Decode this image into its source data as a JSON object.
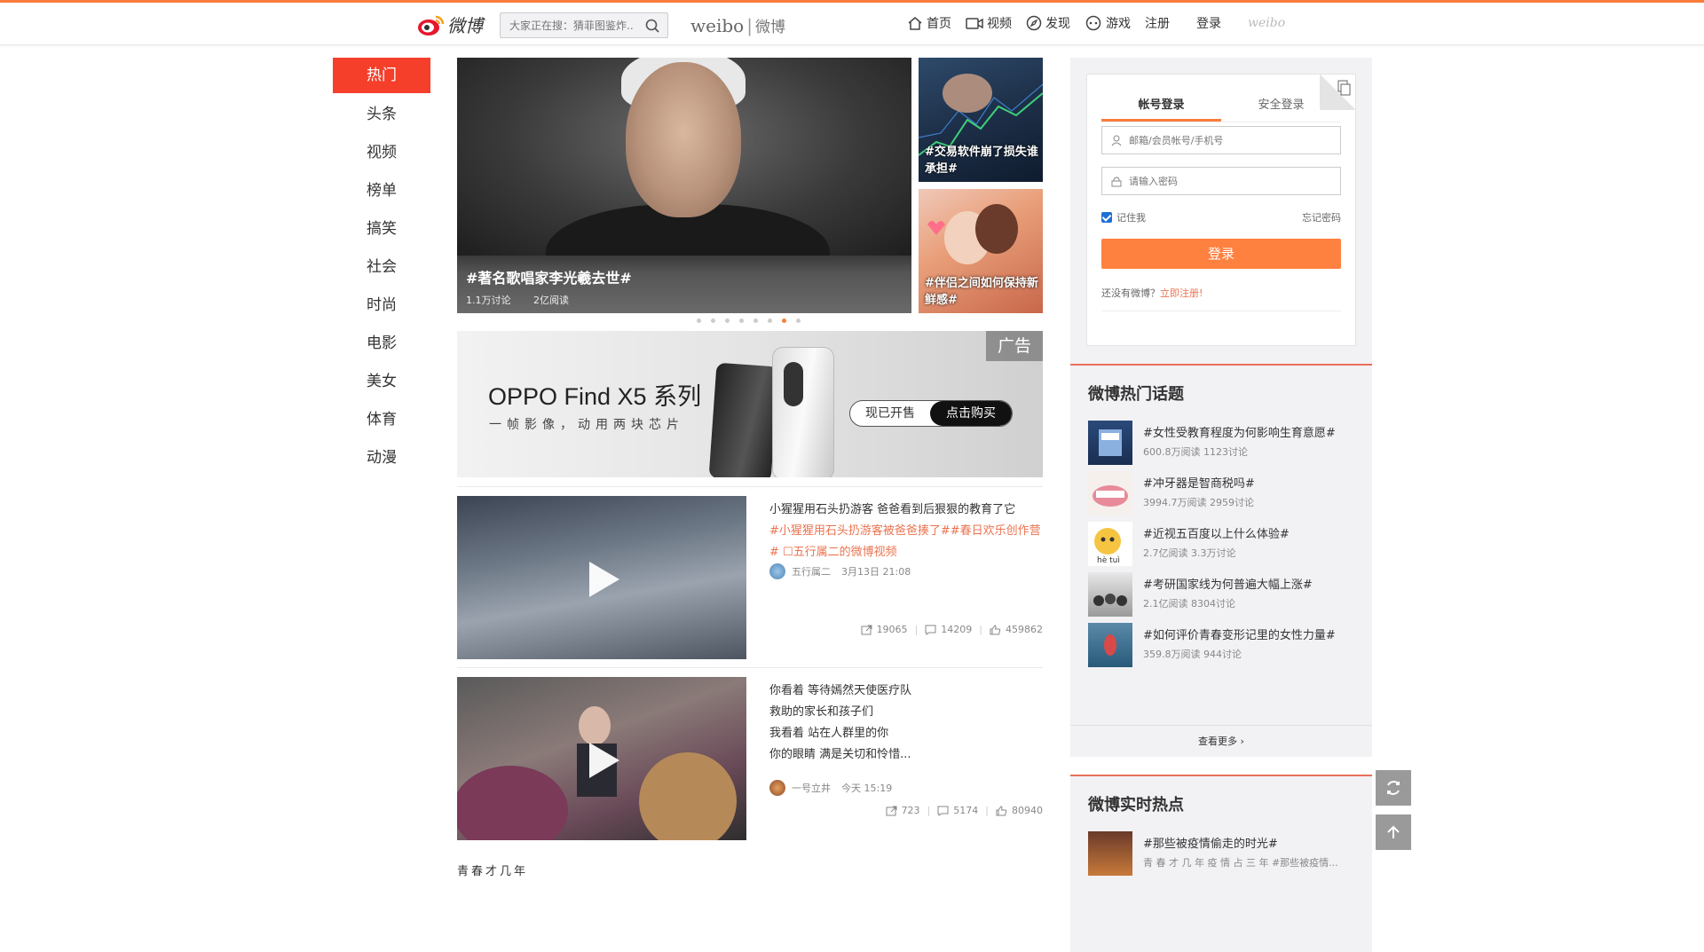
{
  "nav": {
    "logo_text": "微博",
    "search_placeholder": "大家正在搜：猜菲图鉴炸...",
    "brand_en": "weibo",
    "brand_cn": "微博",
    "links": [
      "首页",
      "视频",
      "发现",
      "游戏"
    ],
    "register": "注册",
    "login": "登录",
    "weibo_small": "weibo"
  },
  "left_nav": [
    "热门",
    "头条",
    "视频",
    "榜单",
    "搞笑",
    "社会",
    "时尚",
    "电影",
    "美女",
    "体育",
    "动漫"
  ],
  "hero": {
    "title": "#著名歌唱家李光羲去世#",
    "discuss": "1.1万讨论",
    "reads": "2亿阅读"
  },
  "side_cards": [
    "#交易软件崩了损失谁承担#",
    "#伴侣之间如何保持新鲜感#"
  ],
  "carousel": {
    "count": 8,
    "active": 6
  },
  "ad": {
    "badge": "广告",
    "title": "OPPO Find X5 系列",
    "subtitle": "一帧影像，动用两块芯片",
    "btn_left": "现已开售",
    "btn_right": "点击购买"
  },
  "feed": [
    {
      "text": "小猩猩用石头扔游客 爸爸看到后狠狠的教育了它",
      "tags": "#小猩猩用石头扔游客被爸爸揍了##春日欢乐创作营# ☐五行属二的微博视频",
      "author": "五行属二",
      "date": "3月13日 21:08",
      "shares": "19065",
      "comments": "14209",
      "likes": "459862"
    },
    {
      "lines": [
        "你看着 等待嫣然天使医疗队",
        "救助的家长和孩子们",
        "我看着 站在人群里的你",
        "你的眼睛 满是关切和怜惜..."
      ],
      "author": "一号立井",
      "date": "今天 15:19",
      "shares": "723",
      "comments": "5174",
      "likes": "80940"
    }
  ],
  "bottom_text": "青春才几年",
  "login": {
    "tab_account": "帐号登录",
    "tab_secure": "安全登录",
    "user_placeholder": "邮箱/会员帐号/手机号",
    "pwd_placeholder": "请输入密码",
    "remember": "记住我",
    "forgot": "忘记密码",
    "button": "登录",
    "no_account": "还没有微博？",
    "register_now": "立即注册!"
  },
  "hot_topics": {
    "title": "微博热门话题",
    "items": [
      {
        "title": "#女性受教育程度为何影响生育意愿#",
        "meta": "600.8万阅读 1123讨论"
      },
      {
        "title": "#冲牙器是智商税吗#",
        "meta": "3994.7万阅读 2959讨论"
      },
      {
        "title": "#近视五百度以上什么体验#",
        "meta": "2.7亿阅读 3.3万讨论"
      },
      {
        "title": "#考研国家线为何普遍大幅上涨#",
        "meta": "2.1亿阅读 8304讨论"
      },
      {
        "title": "#如何评价青春变形记里的女性力量#",
        "meta": "359.8万阅读 944讨论"
      }
    ],
    "more": "查看更多 ›",
    "thumb3_text": "hè tuì"
  },
  "realtime": {
    "title": "微博实时热点",
    "items": [
      {
        "title": "#那些被疫情偷走的时光#",
        "meta": "青 春 才 几 年 疫 情 占 三 年 #那些被疫情..."
      }
    ]
  },
  "colors": {
    "accent": "#fa7d3c",
    "active_nav": "#f53f2b",
    "link": "#eb7350"
  }
}
